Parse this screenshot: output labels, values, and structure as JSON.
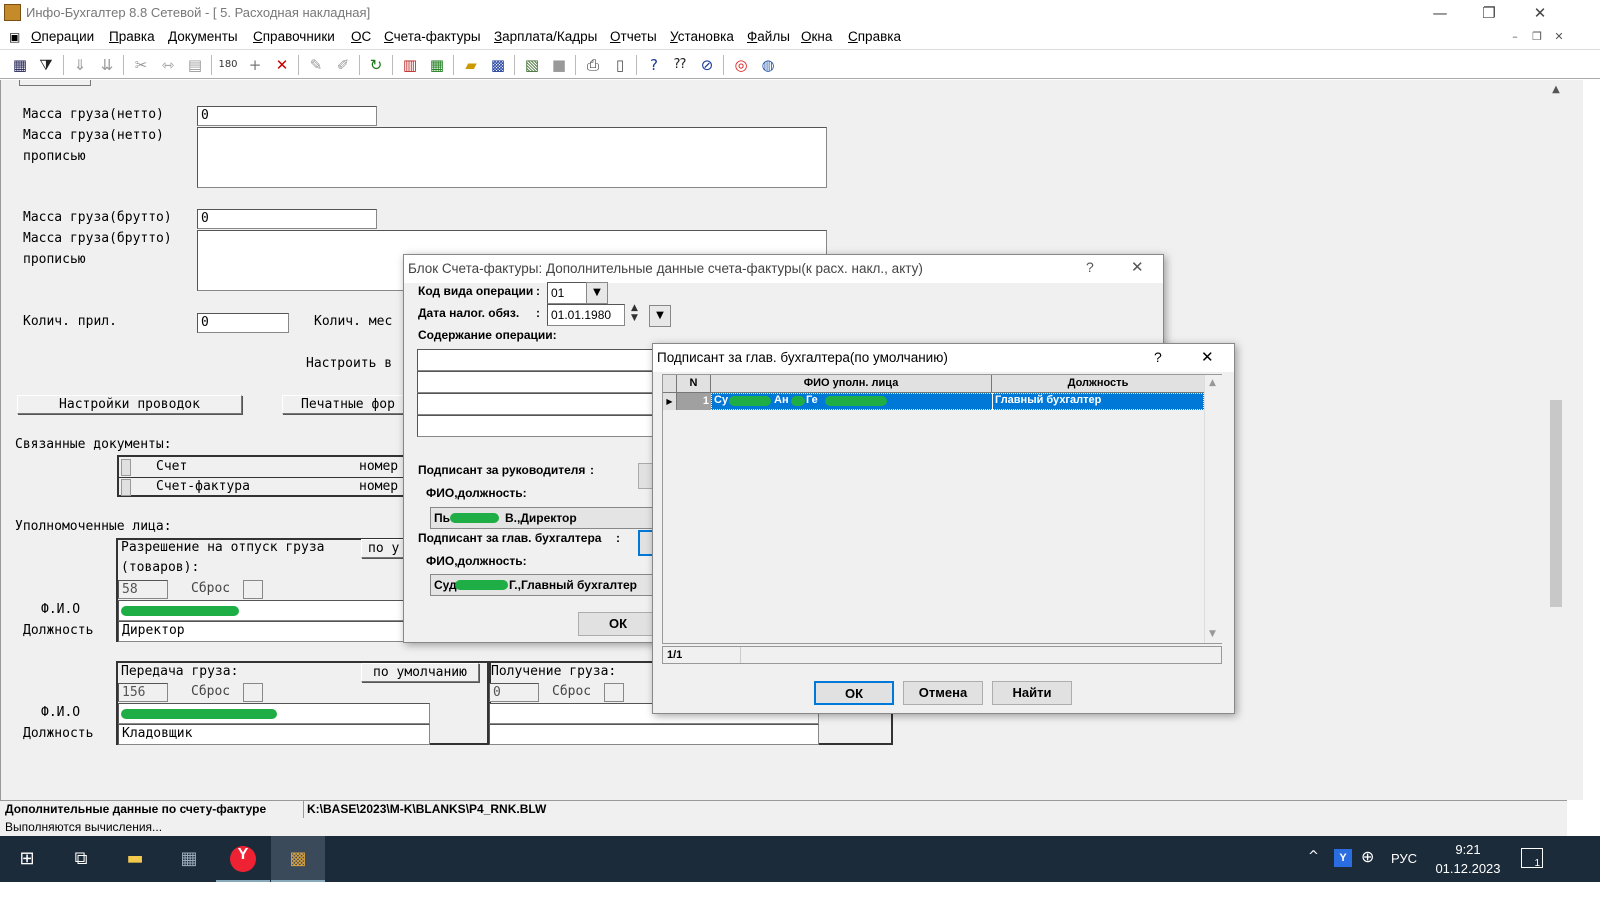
{
  "window": {
    "title": "Инфо-Бухгалтер 8.8 Сетевой - [  5. Расходная накладная]",
    "minimize": "—",
    "restore": "❐",
    "close": "✕"
  },
  "menu": {
    "items": [
      {
        "label": "Операции",
        "u": "О",
        "rest": "перации"
      },
      {
        "label": "Правка",
        "u": "П",
        "rest": "равка"
      },
      {
        "label": "Документы",
        "u": "Д",
        "rest": "окументы"
      },
      {
        "label": "Справочники",
        "u": "С",
        "rest": "правочники"
      },
      {
        "label": "ОС",
        "u": "О",
        "rest": "С"
      },
      {
        "label": "Счета-фактуры",
        "u": "С",
        "rest": "чета-фактуры"
      },
      {
        "label": "Зарплата/Кадры",
        "u": "З",
        "rest": "арплата/Кадры"
      },
      {
        "label": "Отчеты",
        "u": "О",
        "rest": "тчеты"
      },
      {
        "label": "Установка",
        "u": "У",
        "rest": "становка"
      },
      {
        "label": "Файлы",
        "u": "Ф",
        "rest": "айлы"
      },
      {
        "label": "Окна",
        "u": "О",
        "rest": "кна"
      },
      {
        "label": "Справка",
        "u": "С",
        "rest": "правка"
      }
    ],
    "mdi_min": "–",
    "mdi_restore": "❐",
    "mdi_close": "✕"
  },
  "toolbar": {
    "icons": [
      "grid-icon",
      "filter-icon",
      "sort-asc-icon",
      "sort-desc-icon",
      "cut-icon",
      "move-icon",
      "paste-icon",
      "calc180-icon",
      "add-icon",
      "delete-icon",
      "pen-icon",
      "pen2-icon",
      "refresh-icon",
      "report-icon",
      "table-icon",
      "open-folder-icon",
      "save-icon",
      "book-icon",
      "blank-icon",
      "print-icon",
      "preview-icon",
      "help-icon",
      "help-pointer-icon",
      "compass-icon",
      "lifebuoy-icon",
      "globe-icon"
    ]
  },
  "form": {
    "mass_net_label": "Масса груза(нетто)",
    "mass_net_value": "0",
    "mass_net_words_label1": "Масса груза(нетто)",
    "mass_net_words_label2": "прописью",
    "mass_gross_label": "Масса груза(брутто)",
    "mass_gross_value": "0",
    "mass_gross_words_label1": "Масса груза(брутто)",
    "mass_gross_words_label2": "прописью",
    "attach_label": "Колич. прил.",
    "attach_value": "0",
    "places_label": "Колич. мес",
    "configure_label": "Настроить в",
    "postings_button": "Настройки проводок",
    "print_forms_button": "Печатные фор",
    "linked_docs_label": "Связанные документы:",
    "linked_docs": [
      {
        "name": "Счет",
        "num": "номер"
      },
      {
        "name": "Счет-фактура",
        "num": "номер"
      }
    ],
    "authorized_label": "Уполномоченные лица:",
    "release_label1": "Разрешение на отпуск груза",
    "release_label2": "(товаров):",
    "release_default": "по у",
    "release_code": "58",
    "reset_label": "Сброс",
    "fio_label": "Ф.И.О",
    "position_label": "Должность",
    "release_position": "Директор",
    "transfer_label": "Передача груза:",
    "transfer_default": "по умолчанию",
    "transfer_code": "156",
    "transfer_position": "Кладовщик",
    "receive_label": "Получение груза:",
    "receive_code": "0"
  },
  "dialog1": {
    "title": "Блок Счета-фактуры: Дополнительные данные счета-фактуры(к расх. накл., акту)",
    "help": "?",
    "close": "✕",
    "op_code_label": "Код вида операции",
    "op_code_value": "01",
    "tax_date_label": "Дата налог. обяз.",
    "tax_date_value": "01.01.1980",
    "colon": ":",
    "op_content_label": "Содержание операции:",
    "signer_head_label": "Подписант за руководителя",
    "fio_position_label": "ФИО,должность:",
    "signer_head_value_left": "Пь",
    "signer_head_value_right": "В.,Директор",
    "signer_chief_label": "Подписант за глав. бухгалтера",
    "fio_position_label2": "ФИО,должность:",
    "signer_chief_value_left": "Суд",
    "signer_chief_value_right": "Г.,Главный бухгалтер",
    "ok": "ОК"
  },
  "dialog2": {
    "title": "Подписант за глав. бухгалтера(по умолчанию)",
    "help": "?",
    "close": "✕",
    "columns": [
      "N",
      "ФИО уполн. лица",
      "Должность"
    ],
    "rows": [
      {
        "n": "1",
        "fio_a": "Су",
        "fio_b": "Ан",
        "fio_c": "Ге",
        "position": "Главный бухгалтер"
      }
    ],
    "counter": "1/1",
    "ok": "ОК",
    "cancel": "Отмена",
    "find": "Найти"
  },
  "status": {
    "panel1": "Дополнительные данные по счету-фактуре",
    "panel2": "K:\\BASE\\2023\\M-K\\BLANKS\\P4_RNK.BLW",
    "line2": "Выполняются вычисления..."
  },
  "taskbar": {
    "lang": "РУС",
    "time": "9:21",
    "date": "01.12.2023",
    "notifications": "1",
    "colors": {
      "bg": "#1c2b3a",
      "accent": "#1fae46",
      "selection": "#0078d7"
    }
  }
}
